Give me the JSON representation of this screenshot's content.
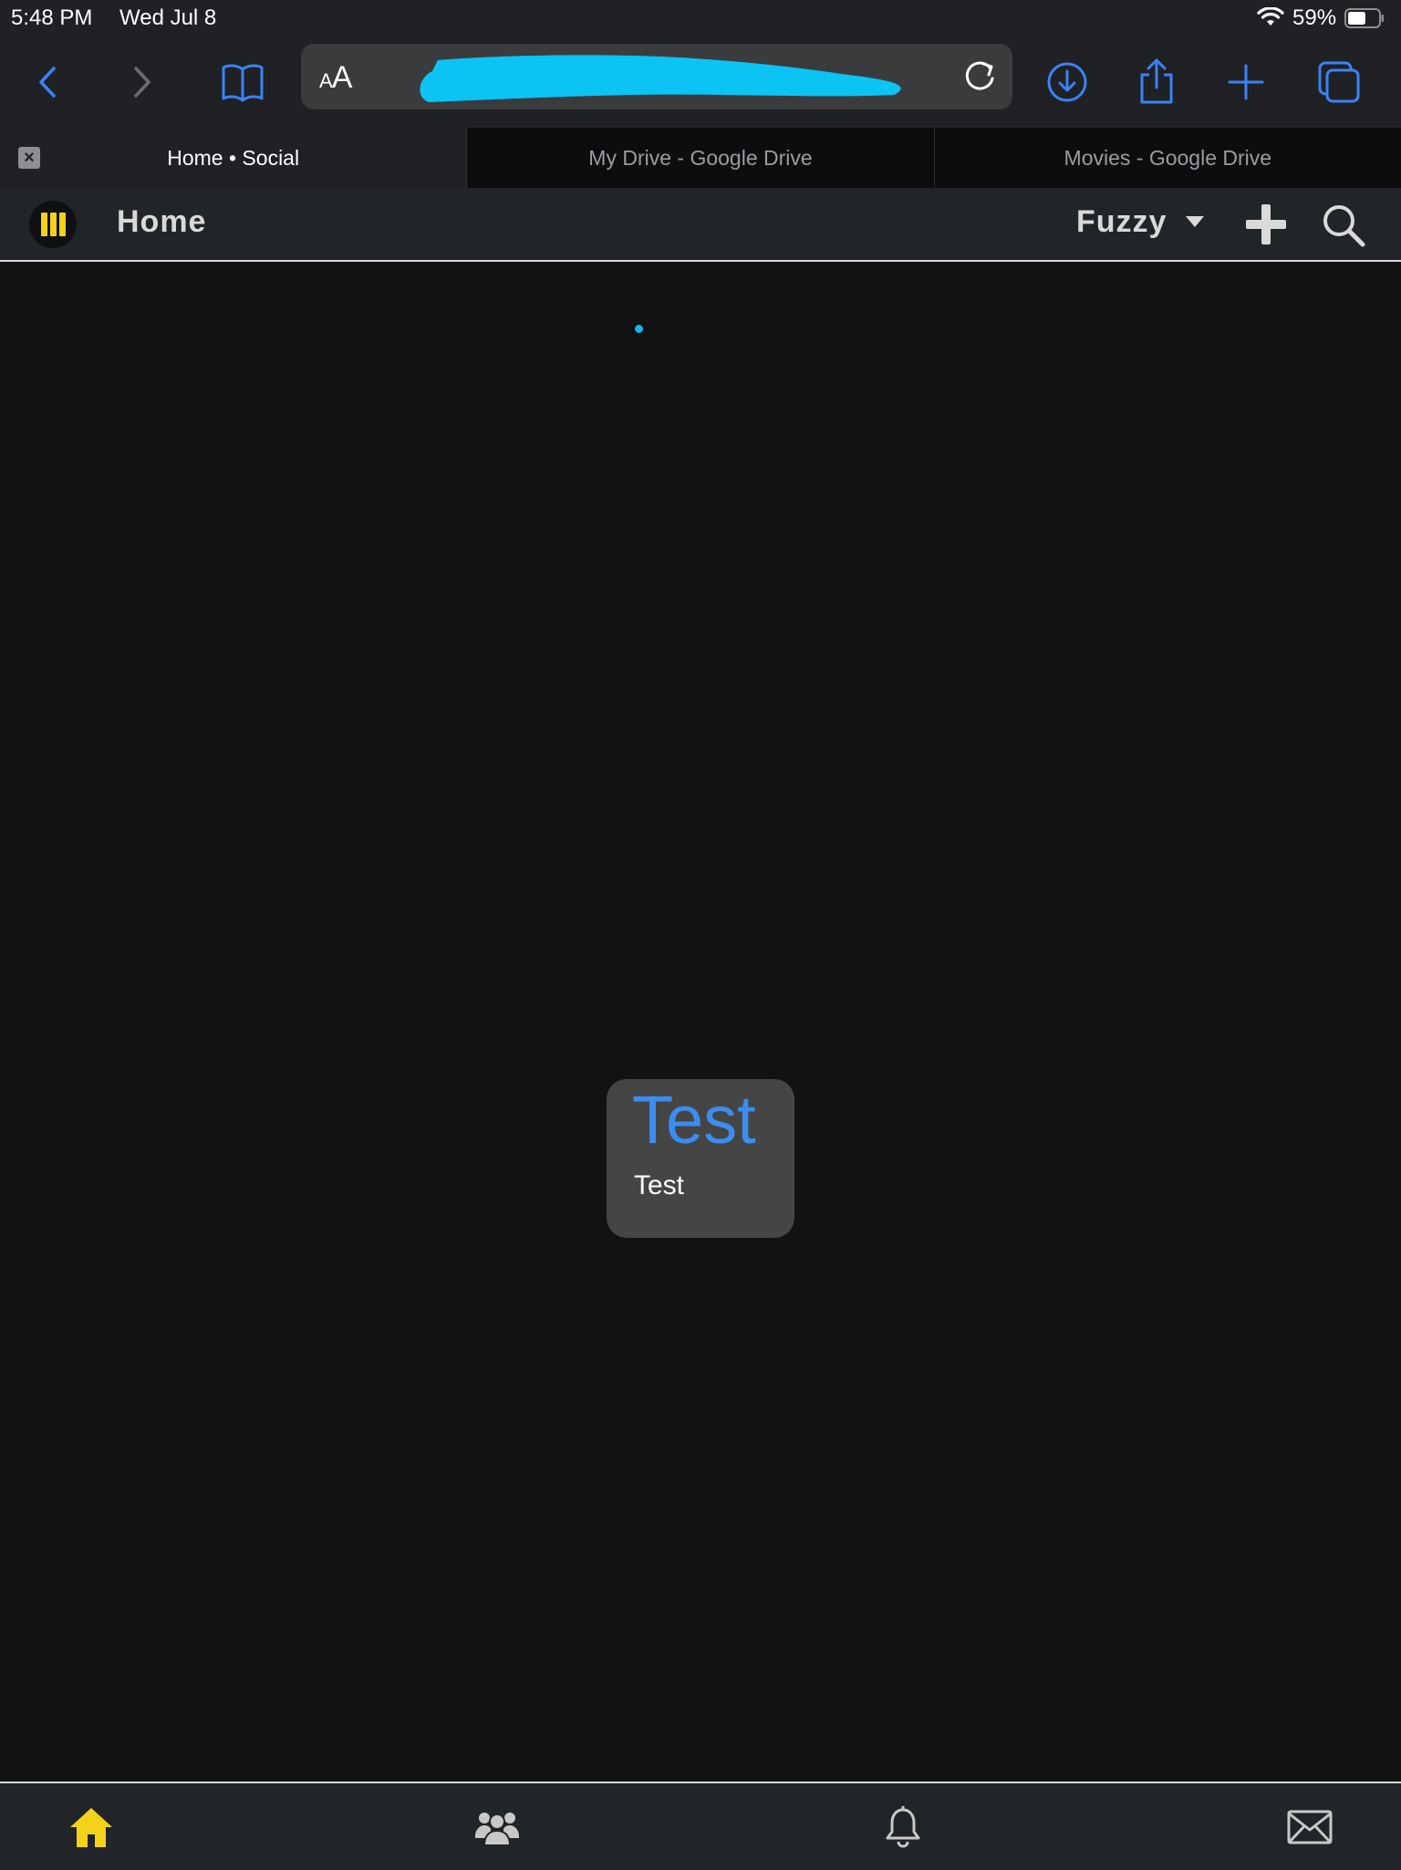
{
  "status_bar": {
    "time": "5:48 PM",
    "date": "Wed Jul 8",
    "battery_percent": "59%",
    "battery_level": 0.59
  },
  "browser": {
    "text_size_label_small": "A",
    "text_size_label_large": "A",
    "redaction_color": "#0bc4f4",
    "accent_color": "#3b82f6",
    "icons": [
      "back-icon",
      "forward-icon",
      "bookmarks-icon",
      "reload-icon",
      "download-icon",
      "share-icon",
      "new-tab-icon",
      "tabs-icon"
    ]
  },
  "tabs": [
    {
      "title": "Home • Social",
      "active": true
    },
    {
      "title": "My Drive - Google Drive",
      "active": false
    },
    {
      "title": "Movies - Google Drive",
      "active": false
    }
  ],
  "app": {
    "title": "Home",
    "user_name": "Fuzzy",
    "brand_color": "#f5d21a"
  },
  "card": {
    "title": "Test",
    "body": "Test"
  },
  "bottom_nav": [
    {
      "name": "home-icon",
      "active": true
    },
    {
      "name": "people-icon",
      "active": false
    },
    {
      "name": "bell-icon",
      "active": false
    },
    {
      "name": "mail-icon",
      "active": false
    }
  ]
}
